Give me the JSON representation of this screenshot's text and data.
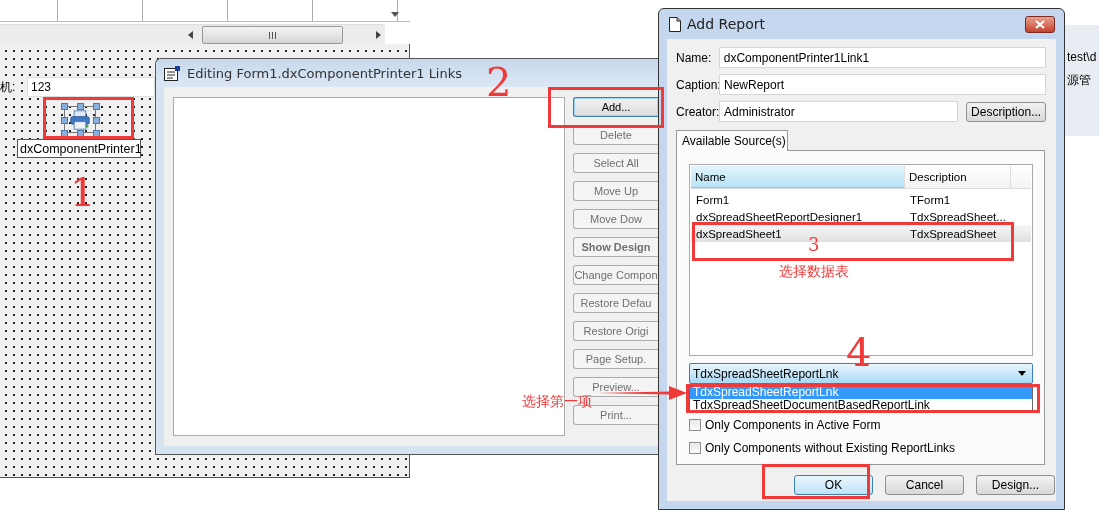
{
  "designer": {
    "label": "机:",
    "input_value": "123",
    "component_caption": "dxComponentPrinter1",
    "component_selected": true
  },
  "editing_window": {
    "title": "Editing Form1.dxComponentPrinter1 Links",
    "buttons": [
      {
        "label": "Add...",
        "disabled": false,
        "focused": true,
        "default": false
      },
      {
        "label": "Delete",
        "disabled": true,
        "focused": false,
        "default": false
      },
      {
        "label": "Select All",
        "disabled": true,
        "focused": false,
        "default": false
      },
      {
        "label": "Move Up",
        "disabled": true,
        "focused": false,
        "default": false
      },
      {
        "label": "Move Dow",
        "disabled": true,
        "focused": false,
        "default": false
      },
      {
        "label": "Show Design",
        "disabled": true,
        "focused": false,
        "default": true
      },
      {
        "label": "Change Compon",
        "disabled": true,
        "focused": false,
        "default": false
      },
      {
        "label": "Restore Defau",
        "disabled": true,
        "focused": false,
        "default": false
      },
      {
        "label": "Restore Origi",
        "disabled": true,
        "focused": false,
        "default": false
      },
      {
        "label": "Page Setup.",
        "disabled": true,
        "focused": false,
        "default": false
      },
      {
        "label": "Preview...",
        "disabled": true,
        "focused": false,
        "default": false
      },
      {
        "label": "Print...",
        "disabled": true,
        "focused": false,
        "default": false
      }
    ]
  },
  "add_report": {
    "title": "Add Report",
    "fields": [
      {
        "label": "Name:",
        "value": "dxComponentPrinter1Link1"
      },
      {
        "label": "Caption:",
        "value": "NewReport"
      },
      {
        "label": "Creator:",
        "value": "Administrator"
      }
    ],
    "description_button": "Description...",
    "tab": {
      "label": "Available Source(s)",
      "selected": true
    },
    "columns": [
      {
        "label": "Name",
        "selected": true
      },
      {
        "label": "Description",
        "selected": false
      }
    ],
    "rows": [
      {
        "name": "Form1",
        "description": "TForm1",
        "selected": false
      },
      {
        "name": "dxSpreadSheetReportDesigner1",
        "description": "TdxSpreadSheet...",
        "selected": false
      },
      {
        "name": "dxSpreadSheet1",
        "description": "TdxSpreadSheet",
        "selected": true
      }
    ],
    "combo": {
      "value": "TdxSpreadSheetReportLnk"
    },
    "dropdown": [
      {
        "label": "TdxSpreadSheetReportLnk",
        "selected": true
      },
      {
        "label": "TdxSpreadSheetDocumentBasedReportLink",
        "selected": false
      }
    ],
    "checkboxes": [
      {
        "label": "Only Components in Active Form",
        "checked": false
      },
      {
        "label": "Only Components without Existing ReportLinks",
        "checked": false
      }
    ],
    "buttons": [
      {
        "label": "OK",
        "focused": true
      },
      {
        "label": "Cancel",
        "focused": false
      },
      {
        "label": "Design...",
        "focused": false
      }
    ]
  },
  "background_panel": {
    "texts": [
      "test\\d",
      "源管"
    ]
  },
  "annotations": [
    {
      "kind": "box"
    },
    {
      "kind": "number",
      "text": "1"
    },
    {
      "kind": "number",
      "text": "2"
    },
    {
      "kind": "box"
    },
    {
      "kind": "note",
      "text": "选择第一项"
    },
    {
      "kind": "arrow"
    },
    {
      "kind": "number",
      "text": "3"
    },
    {
      "kind": "box"
    },
    {
      "kind": "note",
      "text": "选择数据表"
    },
    {
      "kind": "number",
      "text": "4"
    },
    {
      "kind": "box"
    },
    {
      "kind": "box"
    }
  ]
}
